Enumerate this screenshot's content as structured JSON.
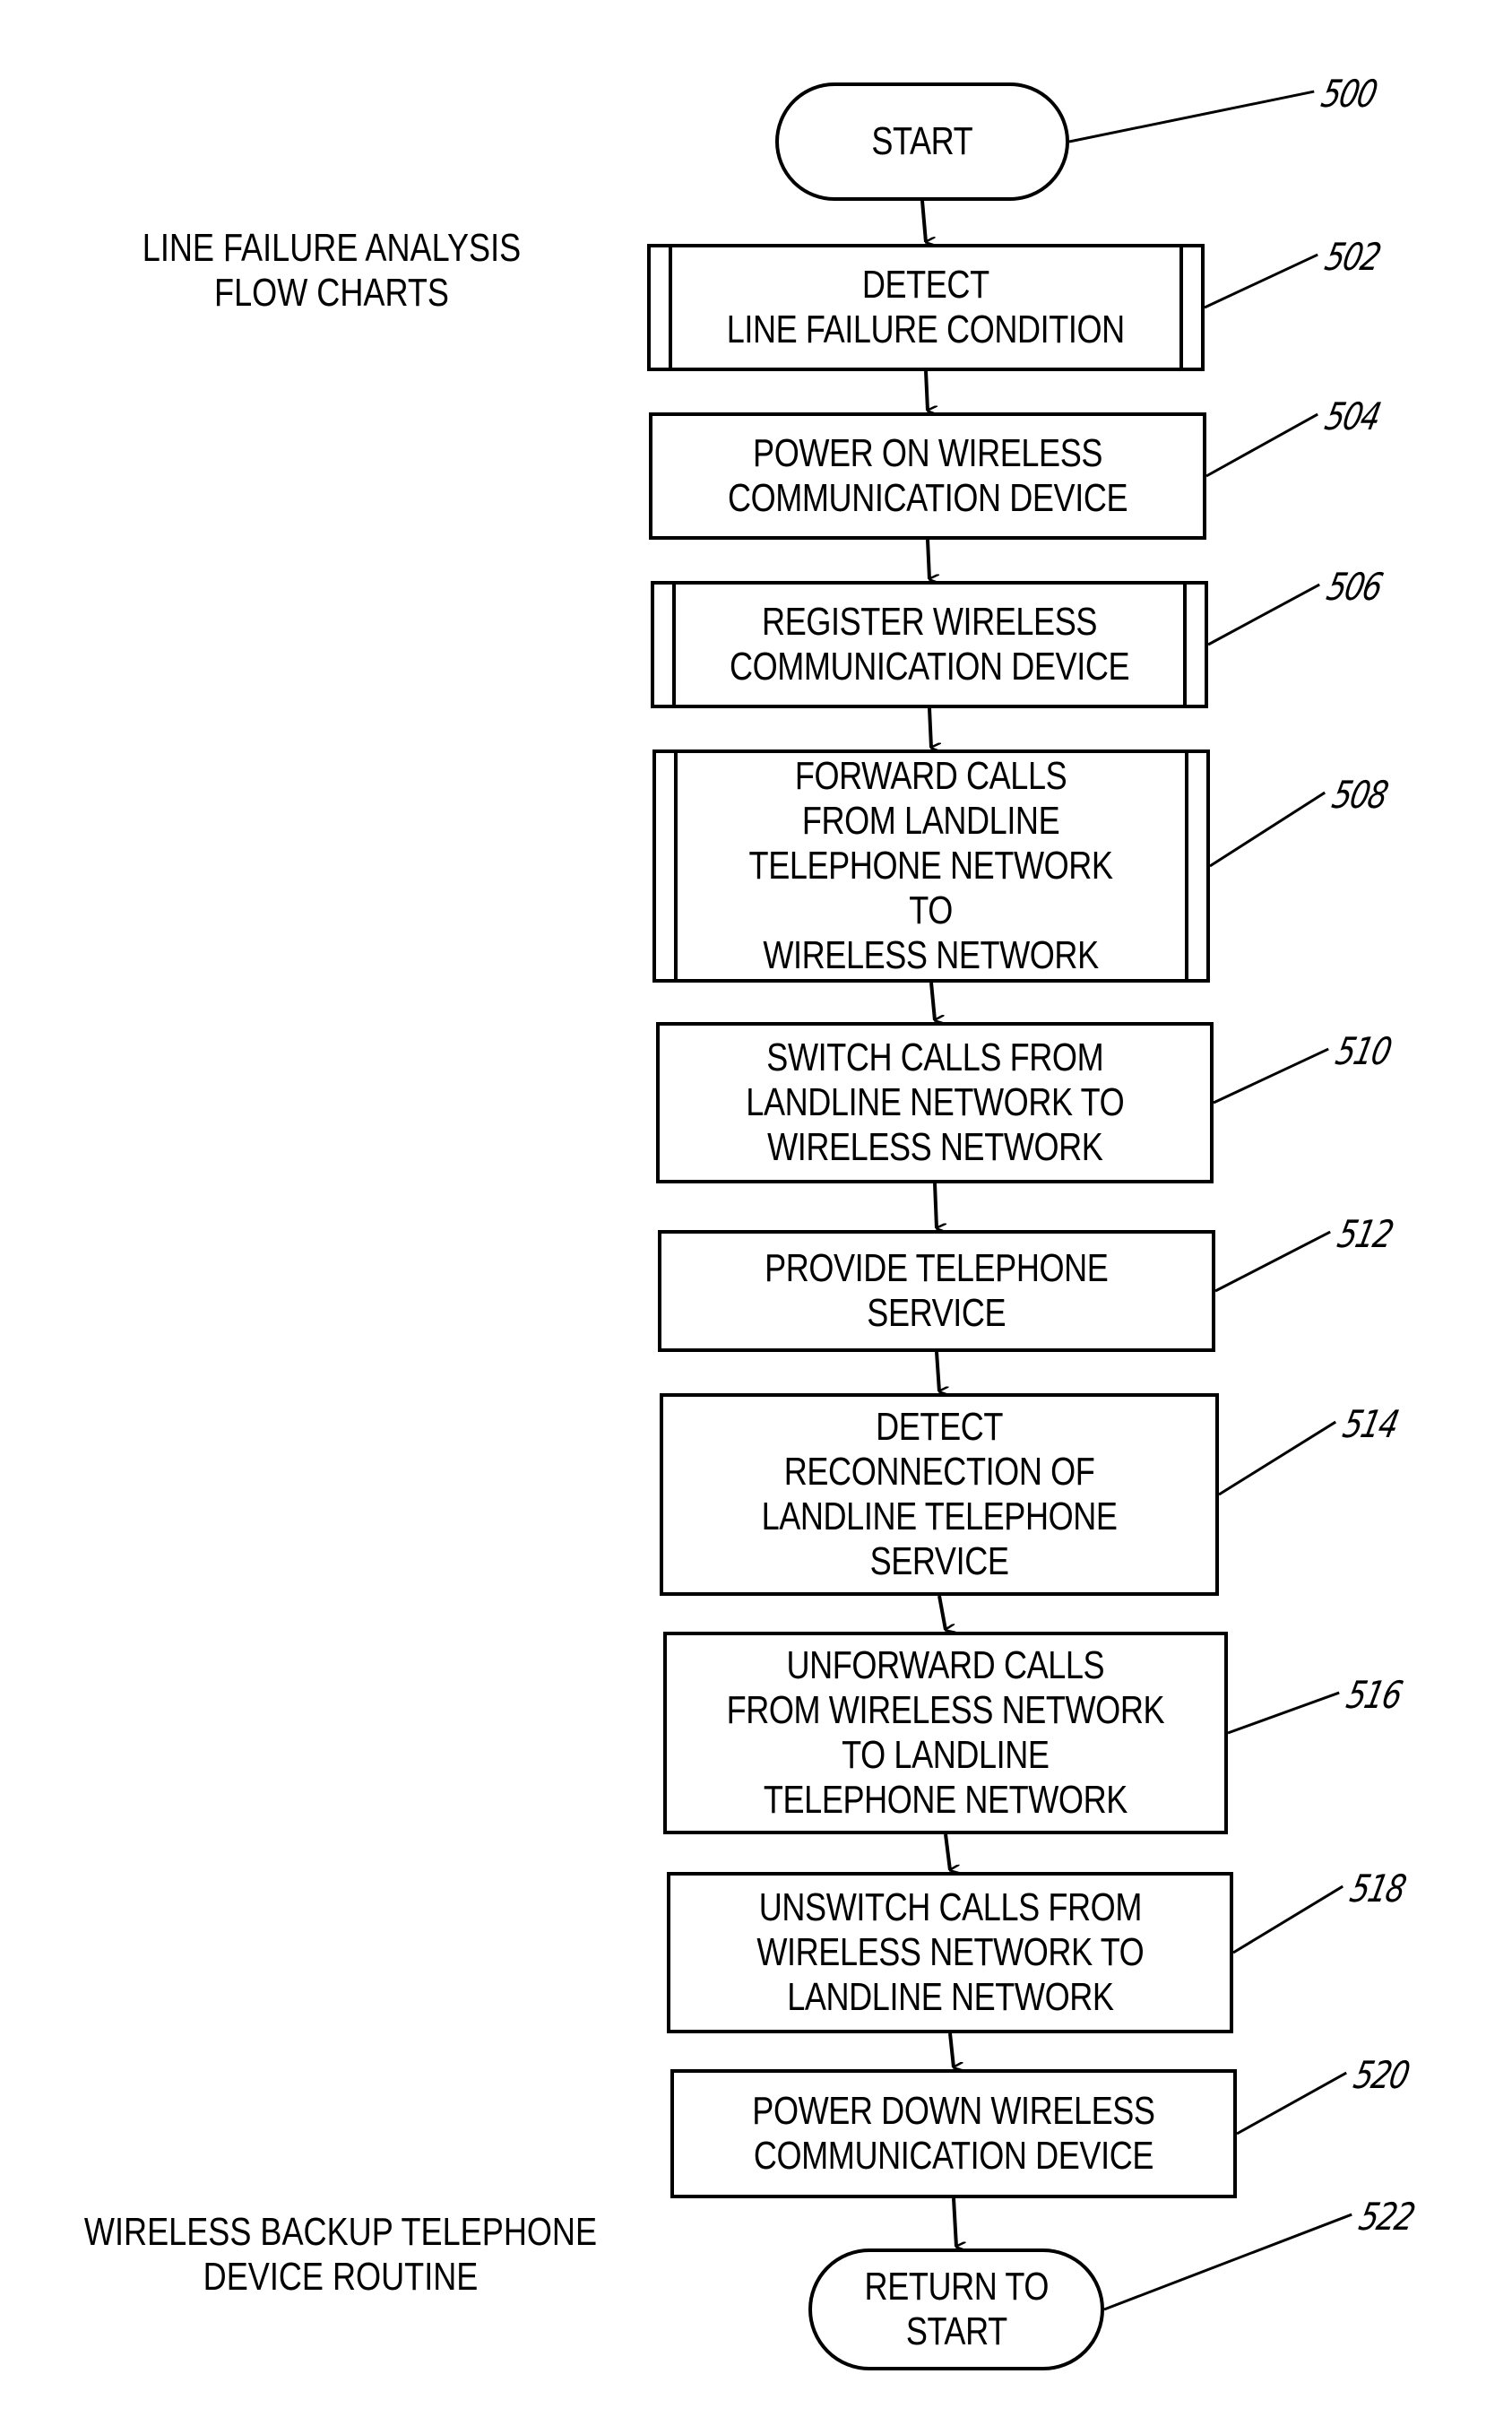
{
  "labels": {
    "top_title": "LINE FAILURE ANALYSIS\nFLOW CHARTS",
    "bottom_title": "WIRELESS BACKUP TELEPHONE\nDEVICE ROUTINE"
  },
  "nodes": [
    {
      "ref": "500",
      "type": "terminal",
      "text": "START"
    },
    {
      "ref": "502",
      "type": "predefined",
      "text": "DETECT\nLINE FAILURE CONDITION"
    },
    {
      "ref": "504",
      "type": "process",
      "text": "POWER ON WIRELESS\nCOMMUNICATION DEVICE"
    },
    {
      "ref": "506",
      "type": "predefined",
      "text": "REGISTER WIRELESS\nCOMMUNICATION DEVICE"
    },
    {
      "ref": "508",
      "type": "predefined",
      "text": "FORWARD CALLS\nFROM LANDLINE\nTELEPHONE NETWORK\nTO\nWIRELESS NETWORK"
    },
    {
      "ref": "510",
      "type": "process",
      "text": "SWITCH CALLS FROM\nLANDLINE NETWORK TO\nWIRELESS NETWORK"
    },
    {
      "ref": "512",
      "type": "process",
      "text": "PROVIDE TELEPHONE\nSERVICE"
    },
    {
      "ref": "514",
      "type": "process",
      "text": "DETECT\nRECONNECTION OF\nLANDLINE TELEPHONE\nSERVICE"
    },
    {
      "ref": "516",
      "type": "process",
      "text": "UNFORWARD CALLS\nFROM WIRELESS NETWORK\nTO LANDLINE\nTELEPHONE NETWORK"
    },
    {
      "ref": "518",
      "type": "process",
      "text": "UNSWITCH CALLS FROM\nWIRELESS NETWORK TO\nLANDLINE NETWORK"
    },
    {
      "ref": "520",
      "type": "process",
      "text": "POWER DOWN WIRELESS\nCOMMUNICATION DEVICE"
    },
    {
      "ref": "522",
      "type": "terminal",
      "text": "RETURN TO\nSTART"
    }
  ]
}
